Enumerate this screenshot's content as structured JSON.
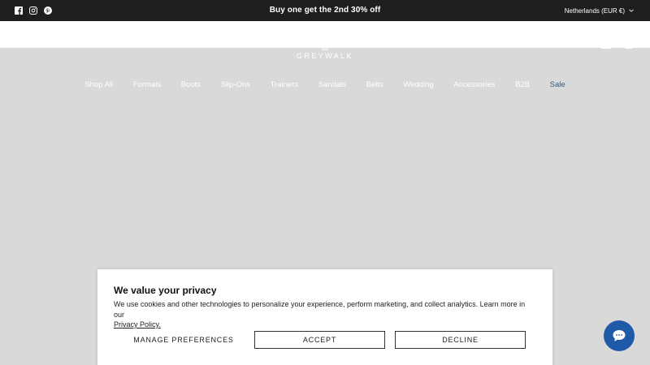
{
  "announcement": {
    "social_icons": [
      "facebook-icon",
      "instagram-icon",
      "pinterest-icon"
    ],
    "text": "Buy one get the 2nd 30% off",
    "locale": "Netherlands (EUR €)"
  },
  "header": {
    "logo": "GREYWALK",
    "icons": [
      "search-icon",
      "account-icon",
      "cart-icon"
    ]
  },
  "nav": {
    "items": [
      "Shop All",
      "Formals",
      "Boots",
      "Slip-Ons",
      "Trainers",
      "Sandals",
      "Belts",
      "Wedding",
      "Accessories",
      "B2B",
      "Sale"
    ]
  },
  "cookie": {
    "title": "We value your privacy",
    "body": "We use cookies and other technologies to personalize your experience, perform marketing, and collect analytics. Learn more in our",
    "link": "Privacy Policy.",
    "manage": "Manage Preferences",
    "accept": "Accept",
    "decline": "Decline"
  },
  "colors": {
    "announcement_bg": "#1e1e1e",
    "overlay_bg": "#d9d9d9",
    "sale": "#2c5e85",
    "chat_bg": "#1f5aa8"
  }
}
